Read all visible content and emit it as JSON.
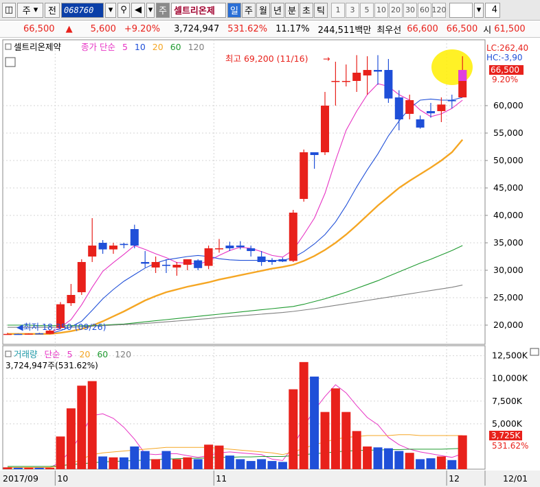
{
  "toolbar": {
    "type_label": "주",
    "prev_label": "전",
    "code": "068760",
    "stock_name": "셀트리온제",
    "periods": [
      "일",
      "주",
      "월",
      "년",
      "분",
      "초",
      "틱"
    ],
    "active_period": "일",
    "intervals": [
      "1",
      "3",
      "5",
      "10",
      "20",
      "30",
      "60",
      "120"
    ],
    "count": "4"
  },
  "quote": {
    "price": "66,500",
    "up_arrow": "▲",
    "change": "5,600",
    "change_rate": "+9.20%",
    "volume": "3,724,947",
    "vol_ratio": "531.62%",
    "turnover": "11.17%",
    "amount": "244,511백만",
    "best_bid_label": "최우선",
    "ask": "66,600",
    "bid": "66,500",
    "open_label": "시",
    "open": "61,500"
  },
  "price_panel": {
    "legend_name": "셀트리온제약",
    "legend_ma": "종가 단순",
    "ma_periods": [
      "5",
      "10",
      "20",
      "60",
      "120"
    ],
    "lc": "LC:262,40",
    "hc": "HC:-3,90",
    "last_price": "66,500",
    "last_rate": "9.20%",
    "high_annotation": "최고 69,200 (11/16)",
    "low_annotation": "최저 18,350 (09/26)"
  },
  "volume_panel": {
    "legend_name": "거래량",
    "legend_ma": "단순",
    "ma_periods": [
      "5",
      "20",
      "60",
      "120"
    ],
    "current_text": "3,724,947주(531.62%)",
    "last_volume": "3,725K",
    "last_rate": "531.62%"
  },
  "colors": {
    "up": "#e8211b",
    "down": "#1f4fd8",
    "ma5": "#e733c4",
    "ma10": "#1f4fd8",
    "ma20": "#f5a623",
    "ma60": "#1e9a2f",
    "ma120": "#808080",
    "highlight": "#ffee00"
  },
  "chart_data": [
    {
      "type": "candlestick",
      "yticks": [
        20000,
        25000,
        30000,
        35000,
        40000,
        45000,
        50000,
        55000,
        60000
      ],
      "ylim": [
        16500,
        72000
      ],
      "x_labels": [
        {
          "label": "2017/09",
          "index": 0
        },
        {
          "label": "10",
          "index": 5
        },
        {
          "label": "11",
          "index": 20
        },
        {
          "label": "12",
          "index": 42
        },
        {
          "label": "12/01",
          "index": 47
        }
      ],
      "candles": [
        {
          "o": 18350,
          "h": 18600,
          "l": 18350,
          "c": 18400
        },
        {
          "o": 18400,
          "h": 18450,
          "l": 18300,
          "c": 18350
        },
        {
          "o": 18350,
          "h": 18500,
          "l": 18300,
          "c": 18450
        },
        {
          "o": 18500,
          "h": 18600,
          "l": 18350,
          "c": 18400
        },
        {
          "o": 18400,
          "h": 19200,
          "l": 18350,
          "c": 19000
        },
        {
          "o": 19500,
          "h": 24200,
          "l": 19200,
          "c": 23800
        },
        {
          "o": 24000,
          "h": 27500,
          "l": 23500,
          "c": 25500
        },
        {
          "o": 26000,
          "h": 32000,
          "l": 25500,
          "c": 31500
        },
        {
          "o": 32500,
          "h": 39500,
          "l": 31500,
          "c": 34500
        },
        {
          "o": 35000,
          "h": 35500,
          "l": 33000,
          "c": 33800
        },
        {
          "o": 33800,
          "h": 35000,
          "l": 33000,
          "c": 34500
        },
        {
          "o": 34800,
          "h": 35000,
          "l": 34000,
          "c": 34600
        },
        {
          "o": 37500,
          "h": 38300,
          "l": 34000,
          "c": 34500
        },
        {
          "o": 31500,
          "h": 33500,
          "l": 30500,
          "c": 31200
        },
        {
          "o": 30500,
          "h": 32500,
          "l": 29500,
          "c": 31500
        },
        {
          "o": 31000,
          "h": 32000,
          "l": 29500,
          "c": 30800
        },
        {
          "o": 30500,
          "h": 31500,
          "l": 29000,
          "c": 31000
        },
        {
          "o": 31000,
          "h": 32000,
          "l": 30000,
          "c": 32000
        },
        {
          "o": 31800,
          "h": 32000,
          "l": 30000,
          "c": 30400
        },
        {
          "o": 30800,
          "h": 34500,
          "l": 30200,
          "c": 34000
        },
        {
          "o": 34000,
          "h": 35700,
          "l": 33200,
          "c": 34000
        },
        {
          "o": 34500,
          "h": 35200,
          "l": 33500,
          "c": 34000
        },
        {
          "o": 34500,
          "h": 35300,
          "l": 33800,
          "c": 34200
        },
        {
          "o": 34000,
          "h": 34500,
          "l": 32500,
          "c": 33500
        },
        {
          "o": 32500,
          "h": 33500,
          "l": 30800,
          "c": 31500
        },
        {
          "o": 31800,
          "h": 32200,
          "l": 31000,
          "c": 31500
        },
        {
          "o": 32000,
          "h": 32300,
          "l": 31500,
          "c": 31600
        },
        {
          "o": 31700,
          "h": 41000,
          "l": 31500,
          "c": 40500
        },
        {
          "o": 43000,
          "h": 52000,
          "l": 42500,
          "c": 51500
        },
        {
          "o": 51500,
          "h": 51500,
          "l": 48500,
          "c": 51000
        },
        {
          "o": 51500,
          "h": 62500,
          "l": 51000,
          "c": 60000
        },
        {
          "o": 64500,
          "h": 68000,
          "l": 60000,
          "c": 64500
        },
        {
          "o": 64500,
          "h": 67500,
          "l": 63500,
          "c": 64500
        },
        {
          "o": 64500,
          "h": 69200,
          "l": 62500,
          "c": 66000
        },
        {
          "o": 65500,
          "h": 69000,
          "l": 62000,
          "c": 66500
        },
        {
          "o": 66500,
          "h": 69200,
          "l": 63800,
          "c": 66200
        },
        {
          "o": 66500,
          "h": 68500,
          "l": 60500,
          "c": 61300
        },
        {
          "o": 61500,
          "h": 62800,
          "l": 55500,
          "c": 57500
        },
        {
          "o": 58500,
          "h": 62000,
          "l": 57500,
          "c": 61000
        },
        {
          "o": 57500,
          "h": 58200,
          "l": 55800,
          "c": 56000
        },
        {
          "o": 59000,
          "h": 60500,
          "l": 57800,
          "c": 58600
        },
        {
          "o": 59000,
          "h": 61500,
          "l": 57000,
          "c": 60200
        },
        {
          "o": 61000,
          "h": 62000,
          "l": 59500,
          "c": 60800
        },
        {
          "o": 61500,
          "h": 69000,
          "l": 61500,
          "c": 66500
        }
      ],
      "moving_averages": [
        {
          "name": "5",
          "values": [
            18400,
            18380,
            18390,
            18400,
            18520,
            19600,
            21000,
            23700,
            26900,
            29800,
            31400,
            32900,
            34500,
            33800,
            33000,
            32300,
            31400,
            31300,
            31100,
            31700,
            32700,
            33600,
            34200,
            34000,
            33400,
            32700,
            32400,
            33700,
            36500,
            39500,
            44000,
            50000,
            55500,
            59000,
            62000,
            64000,
            63500,
            62000,
            61000,
            59200,
            58000,
            58500,
            59500,
            61000
          ]
        },
        {
          "name": "10",
          "values": [
            18400,
            18390,
            18390,
            18390,
            18450,
            19000,
            19700,
            20700,
            22700,
            24800,
            26500,
            28000,
            29200,
            30400,
            31300,
            31900,
            32200,
            32500,
            32700,
            32500,
            32100,
            31900,
            31800,
            31800,
            31800,
            31800,
            31800,
            32300,
            33400,
            34800,
            36500,
            38800,
            41800,
            45200,
            48300,
            51200,
            54500,
            57200,
            59500,
            61000,
            61200,
            61000,
            61000,
            61500
          ]
        },
        {
          "name": "20",
          "values": [
            18400,
            18400,
            18400,
            18400,
            18400,
            18600,
            18900,
            19300,
            19900,
            20700,
            21600,
            22500,
            23500,
            24500,
            25300,
            26000,
            26500,
            27000,
            27400,
            27800,
            28300,
            28700,
            29100,
            29500,
            29900,
            30300,
            30600,
            31000,
            31700,
            32600,
            33700,
            35000,
            36500,
            38200,
            40000,
            41800,
            43400,
            45000,
            46300,
            47500,
            48700,
            50000,
            51500,
            53800
          ]
        },
        {
          "name": "60",
          "values": [
            20000,
            20000,
            20000,
            19900,
            19900,
            19900,
            19900,
            19900,
            19900,
            20000,
            20100,
            20200,
            20400,
            20600,
            20800,
            21000,
            21200,
            21400,
            21600,
            21800,
            22000,
            22200,
            22400,
            22600,
            22800,
            23000,
            23200,
            23400,
            23800,
            24300,
            24800,
            25400,
            26000,
            26700,
            27400,
            28100,
            28900,
            29700,
            30500,
            31300,
            32000,
            32800,
            33600,
            34500
          ]
        },
        {
          "name": "120",
          "values": [
            19600,
            19600,
            19600,
            19600,
            19600,
            19600,
            19600,
            19700,
            19800,
            19900,
            20000,
            20100,
            20200,
            20300,
            20450,
            20600,
            20750,
            20900,
            21050,
            21200,
            21400,
            21550,
            21700,
            21850,
            22000,
            22150,
            22300,
            22500,
            22750,
            23000,
            23300,
            23600,
            23900,
            24200,
            24500,
            24800,
            25100,
            25400,
            25700,
            26000,
            26300,
            26600,
            26900,
            27300
          ]
        }
      ]
    },
    {
      "type": "bar",
      "yticks_label": [
        "5,000K",
        "7,500K",
        "10,000K",
        "12,500K"
      ],
      "yticks": [
        5000,
        7500,
        10000,
        12500
      ],
      "ylim": [
        0,
        13300
      ],
      "unit": "K",
      "values": [
        200,
        150,
        150,
        150,
        150,
        3600,
        6700,
        9200,
        9700,
        1400,
        1300,
        1300,
        2500,
        2000,
        1100,
        2000,
        1100,
        1300,
        1100,
        2700,
        2600,
        1500,
        1100,
        900,
        1100,
        900,
        800,
        8800,
        11800,
        10200,
        6300,
        8900,
        6300,
        4200,
        2500,
        2400,
        2300,
        2000,
        1800,
        1100,
        1200,
        1400,
        1000,
        3725
      ],
      "moving_averages": [
        {
          "name": "5",
          "values": [
            200,
            180,
            170,
            160,
            160,
            800,
            2100,
            3900,
            5900,
            6100,
            5600,
            4600,
            3300,
            1700,
            1600,
            1700,
            1700,
            1500,
            1300,
            1500,
            1800,
            1900,
            1800,
            1700,
            1600,
            1100,
            950,
            2500,
            4700,
            6500,
            8000,
            9300,
            8400,
            7000,
            5700,
            4900,
            3500,
            2700,
            2200,
            1900,
            1700,
            1500,
            1300,
            1700
          ]
        },
        {
          "name": "20",
          "values": [
            200,
            200,
            200,
            200,
            200,
            300,
            600,
            1100,
            1600,
            1800,
            1900,
            2000,
            2100,
            2200,
            2300,
            2400,
            2400,
            2400,
            2400,
            2400,
            2300,
            2200,
            2100,
            2000,
            1900,
            1800,
            1600,
            1900,
            2300,
            2700,
            3000,
            3300,
            3500,
            3600,
            3700,
            3700,
            3700,
            3800,
            3800,
            3700,
            3700,
            3700,
            3700,
            3700
          ]
        },
        {
          "name": "60",
          "values": [
            300,
            300,
            300,
            300,
            300,
            400,
            500,
            600,
            700,
            800,
            850,
            900,
            950,
            1000,
            1050,
            1100,
            1150,
            1200,
            1200,
            1250,
            1300,
            1300,
            1350,
            1350,
            1400,
            1400,
            1400,
            1500,
            1600,
            1700,
            1800,
            1900,
            2000,
            2050,
            2100,
            2100,
            2150,
            2150,
            2200,
            2200,
            2200,
            2200,
            2250,
            2300
          ]
        }
      ]
    }
  ]
}
